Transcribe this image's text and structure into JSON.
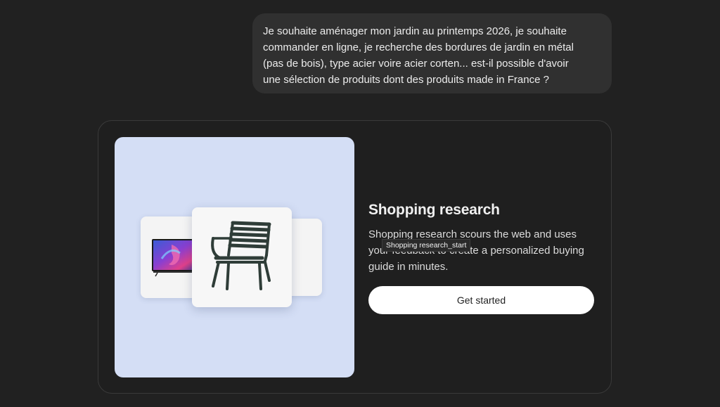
{
  "user_message": {
    "lines": [
      "Je souhaite aménager mon jardin au printemps 2026, je souhaite",
      "commander en ligne, je recherche des bordures de jardin en métal",
      "(pas de bois), type acier voire acier corten... est-il possible d'avoir",
      "une sélection de produits dont des produits made in France ?"
    ]
  },
  "shopping_card": {
    "title": "Shopping research",
    "description_lines": [
      "Shopping research scours the web and uses",
      "your feedback to create a personalized buying",
      "guide in minutes."
    ],
    "tooltip": "Shopping research_start",
    "cta_label": "Get started",
    "hero_icons": [
      "tv-icon",
      "chair-icon",
      "appliance-icon"
    ]
  },
  "colors": {
    "background": "#212121",
    "bubble": "#303030",
    "hero": "#d4def5",
    "button": "#ffffff"
  }
}
